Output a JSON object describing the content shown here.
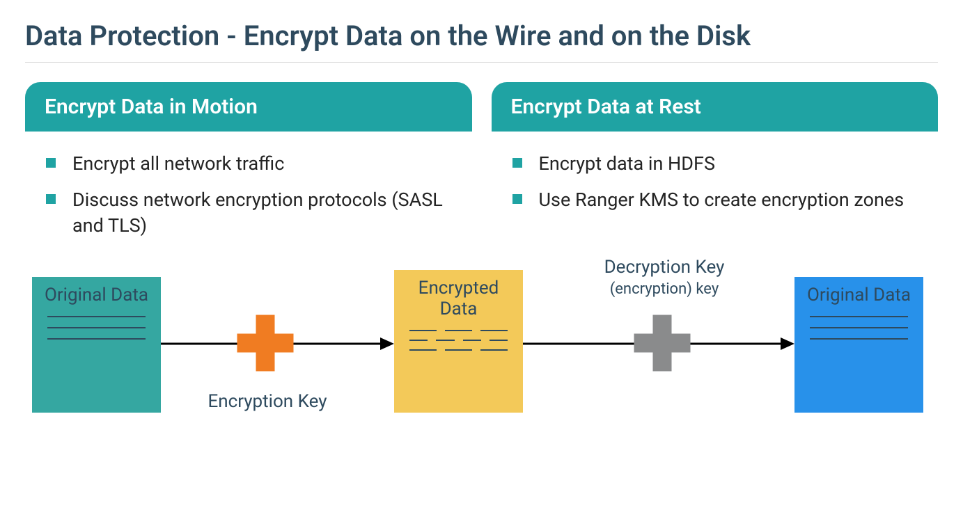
{
  "title": "Data Protection - Encrypt Data on the Wire and on the Disk",
  "left": {
    "heading": "Encrypt Data in Motion",
    "bullets": [
      "Encrypt all network traffic",
      "Discuss network encryption protocols (SASL and TLS)"
    ]
  },
  "right": {
    "heading": "Encrypt Data at Rest",
    "bullets": [
      "Encrypt data in HDFS",
      "Use Ranger KMS to create encryption zones"
    ]
  },
  "diagram": {
    "box1": "Original Data",
    "box2": "Encrypted Data",
    "box3": "Original Data",
    "encKeyLabel": "Encryption Key",
    "decKeyLabel1": "Decryption Key",
    "decKeyLabel2": "(encryption) key"
  },
  "colors": {
    "teal": "#1fa3a3",
    "tealBox": "#35a7a1",
    "yellow": "#f3c959",
    "blue": "#2891ea",
    "orange": "#f07c22",
    "gray": "#8a8b8c",
    "textDark": "#2e4a5e"
  }
}
